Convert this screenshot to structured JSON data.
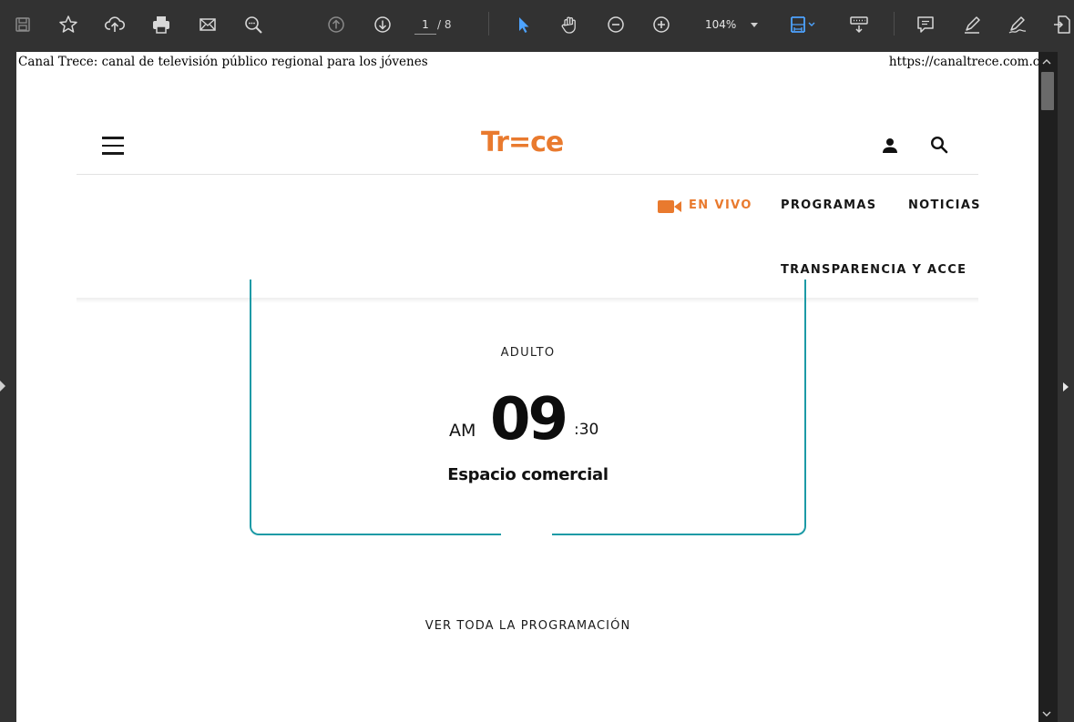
{
  "viewer": {
    "toolbar": {
      "icons": [
        "save-icon",
        "bookmark-star-icon",
        "upload-cloud-icon",
        "print-icon",
        "email-icon",
        "zoom-search-icon",
        "previous-page-icon",
        "next-page-icon",
        "select-cursor-icon",
        "hand-pan-icon",
        "zoom-out-icon",
        "zoom-in-icon",
        "fit-page-icon",
        "read-mode-icon",
        "comment-icon",
        "highlight-pen-icon",
        "sign-icon",
        "export-icon"
      ],
      "page_current": "1",
      "page_total": "/ 8",
      "zoom": "104%",
      "accent_color": "#4da3ff"
    }
  },
  "document": {
    "print_header_title": "Canal Trece: canal de televisión público regional para los jóvenes",
    "print_header_url": "https://canaltrece.com.co/"
  },
  "site": {
    "logo_text": "Tr=ce",
    "brand_color": "#e97a2e",
    "nav": {
      "live_label": "EN VIVO",
      "items": [
        "PROGRAMAS",
        "NOTICIAS",
        "TRANSPARENCIA Y ACCE"
      ]
    },
    "schedule": {
      "category": "ADULTO",
      "ampm": "AM",
      "hour": "09",
      "minutes": ":30",
      "title": "Espacio comercial",
      "accent_color": "#1c9aa6"
    },
    "view_all_label": "VER TODA LA PROGRAMACIÓN"
  }
}
